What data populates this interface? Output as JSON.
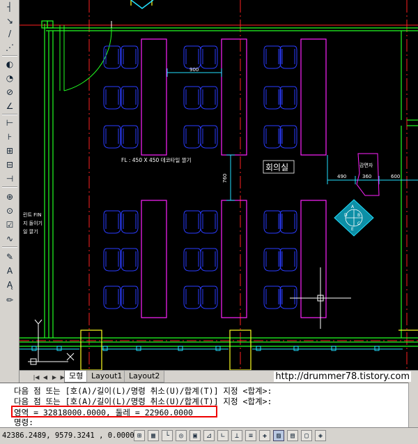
{
  "tabs": [
    {
      "label": "모형",
      "active": true
    },
    {
      "label": "Layout1",
      "active": false
    },
    {
      "label": "Layout2",
      "active": false
    }
  ],
  "watermark": "http://drummer78.tistory.com",
  "drawing": {
    "dim_900": "900",
    "dim_760": "760",
    "dim_490": "490",
    "dim_360": "360",
    "dim_600": "600",
    "floor_note": "FL : 450 X 450 데코타일 깔기",
    "room_label": "회의실",
    "fixture_label": "감면자",
    "left_note_1": "린트 FIN",
    "left_note_2": "지 돌이기",
    "left_note_3": "일 깔기",
    "compass": {
      "a": "A",
      "b": "B",
      "c": "C",
      "d": "D",
      "e": "E"
    }
  },
  "command": {
    "line1": "다음 점 또는 [호(A)/길이(L)/명령 취소(U)/합계(T)] 지정 <합계>:",
    "line2": "다음 점 또는 [호(A)/길이(L)/명령 취소(U)/합계(T)] 지정 <합계>:",
    "line3": "영역 = 32818000.0000, 둘레 = 22960.0000",
    "prompt": "명령:"
  },
  "status": {
    "coordinates": "42386.2489, 9579.3241 , 0.0000"
  },
  "colors": {
    "wall_green": "#22ff22",
    "axis_red": "#ff2020",
    "table_magenta": "#ff22ff",
    "chair_blue": "#2a3cff",
    "dim_cyan": "#22e0ff",
    "door_yellow": "#ffff22",
    "highlight_red": "#e00000"
  }
}
